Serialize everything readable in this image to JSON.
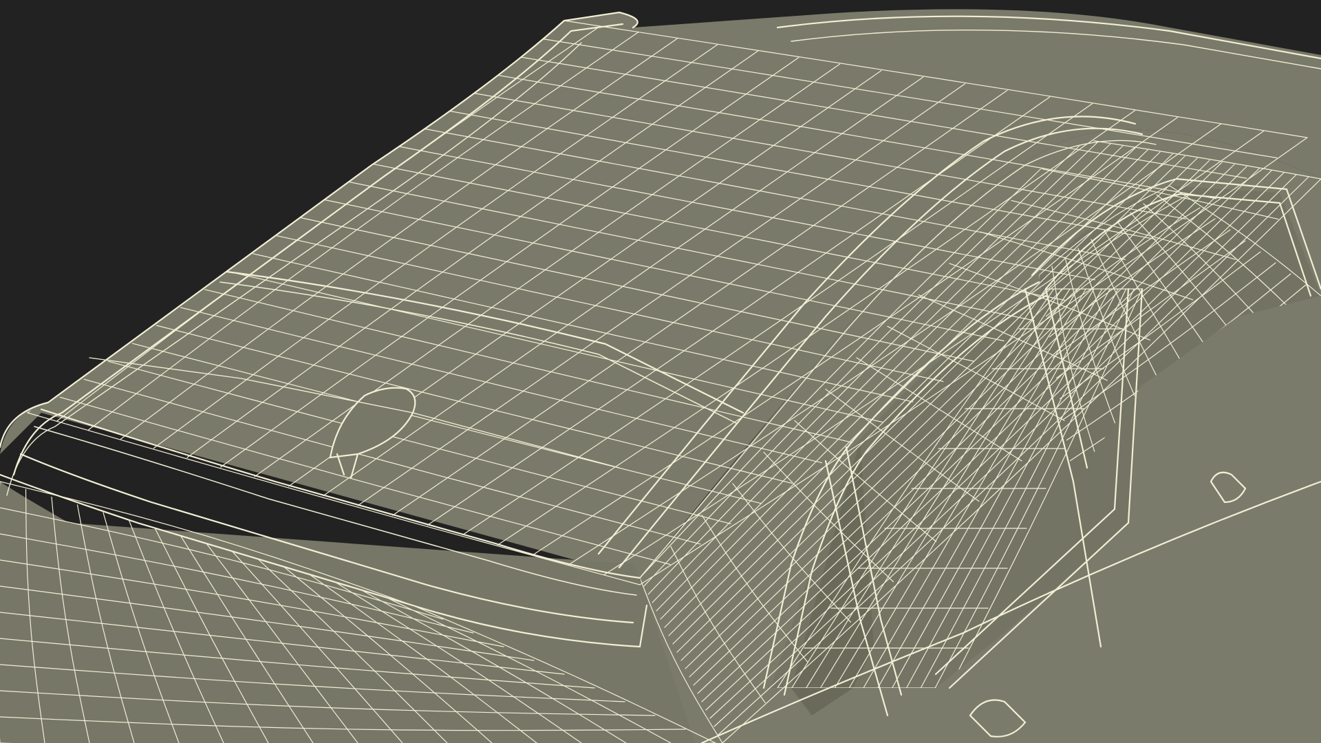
{
  "scene": {
    "subject": "car-wireframe-render",
    "colors": {
      "background": "#222222",
      "surface": "#7a7a6a",
      "surface_dark": "#6c6c5d",
      "surface_light": "#86867a",
      "wire": "#f2efd6"
    }
  }
}
